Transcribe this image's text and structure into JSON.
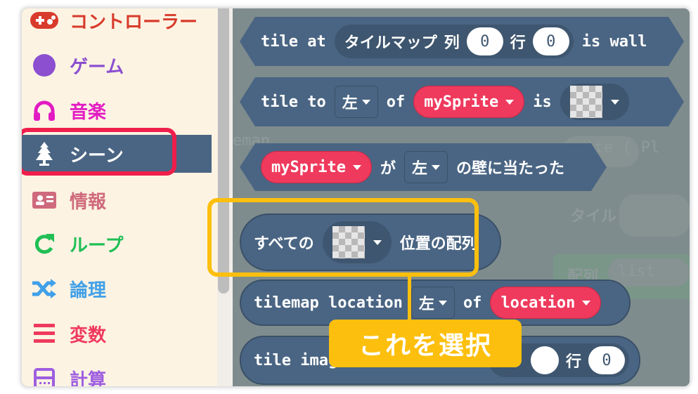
{
  "toolbox": {
    "items": [
      {
        "label": "コントローラー",
        "icon": "gamepad-icon",
        "color": "#d83b2b"
      },
      {
        "label": "ゲーム",
        "icon": "circle-icon",
        "color": "#8b4fcf"
      },
      {
        "label": "音楽",
        "icon": "headphones-icon",
        "color": "#e21bc3"
      },
      {
        "label": "シーン",
        "icon": "tree-icon",
        "color": "#4a6583",
        "selected": true
      },
      {
        "label": "情報",
        "icon": "id-card-icon",
        "color": "#cf6a7d"
      },
      {
        "label": "ループ",
        "icon": "refresh-icon",
        "color": "#20bf55"
      },
      {
        "label": "論理",
        "icon": "shuffle-icon",
        "color": "#40a0e8"
      },
      {
        "label": "変数",
        "icon": "lines-icon",
        "color": "#ef3a5d"
      },
      {
        "label": "計算",
        "icon": "calculator-icon",
        "color": "#9e5ee0"
      }
    ]
  },
  "blocks": {
    "tile_at": {
      "prefix": "tile at",
      "tilemap": "タイルマップ",
      "col_label": "列",
      "col": "0",
      "row_label": "行",
      "row": "0",
      "suffix": "is wall"
    },
    "tile_to": {
      "prefix": "tile to",
      "direction": "左",
      "of": "of",
      "sprite": "mySprite",
      "is": "is"
    },
    "hits_wall": {
      "sprite": "mySprite",
      "ga": "が",
      "direction": "左",
      "suffix": "の壁に当たった"
    },
    "all_locations": {
      "prefix": "すべての",
      "suffix": "位置の配列"
    },
    "tilemap_location": {
      "prefix": "tilemap location",
      "direction": "左",
      "of": "of",
      "variable": "location"
    },
    "tile_image": {
      "prefix": "tile image",
      "row_label": "行",
      "row": "0"
    }
  },
  "background": {
    "ghost_sprite": "rite (  Pl",
    "ghost_tile": "タイル",
    "ghost_array": "配列",
    "ghost_list": "list",
    "ghost_name": "eman"
  },
  "annotation": {
    "callout": "これを選択",
    "color": "#fcbf0d"
  },
  "highlight_color": "#ef1e4b"
}
